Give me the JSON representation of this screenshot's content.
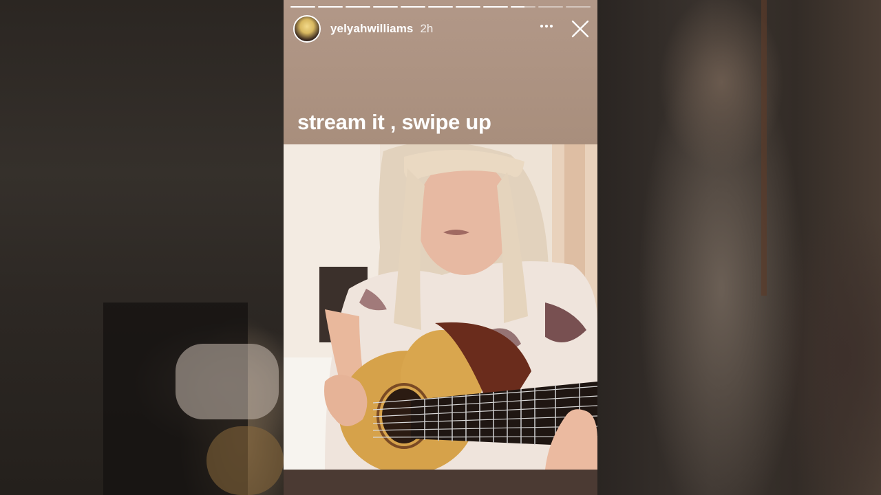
{
  "story": {
    "username": "yelyahwilliams",
    "timestamp": "2h",
    "caption": "stream it , swipe up",
    "more_label": "•••",
    "progress": [
      1,
      1,
      1,
      1,
      1,
      1,
      1,
      1,
      0.55,
      0,
      0
    ]
  },
  "colors": {
    "text": "#ffffff",
    "panel_top": "#b29888",
    "bottom_strip": "#4b3a33"
  },
  "icons": [
    "more-options-icon",
    "close-icon"
  ]
}
